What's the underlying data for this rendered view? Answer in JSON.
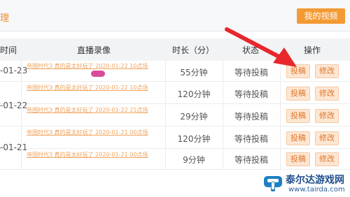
{
  "header": {
    "crumb": "理",
    "my_video_label": "我的视频"
  },
  "table": {
    "columns": [
      "时间",
      "直播录像",
      "时长（分）",
      "状态",
      "操作"
    ],
    "dates": [
      "-01-23",
      "-01-22",
      "-01-21"
    ],
    "rows": [
      {
        "title": "帝国时代3 真的是太好玩了 2020-01-22 10点场",
        "duration": "55分钟",
        "status": "等待投稿"
      },
      {
        "title": "帝国时代3 真的是太好玩了 2020-01-22 10点场",
        "duration": "120分钟",
        "status": "等待投稿"
      },
      {
        "title": "帝国时代3 真的是太好玩了 2020-01-22 21点场",
        "duration": "29分钟",
        "status": "等待投稿"
      },
      {
        "title": "帝国时代3 真的是太好玩了 2020-01-21 00点场",
        "duration": "120分钟",
        "status": "等待投稿"
      },
      {
        "title": "帝国时代3 真的是太好玩了 2020-01-21 00点场",
        "duration": "9分钟",
        "status": "等待投稿"
      }
    ],
    "submit_label": "投稿",
    "edit_label": "修改"
  },
  "watermark": {
    "name": "泰尔达游戏网",
    "url": "www.tairda.com"
  },
  "colors": {
    "accent": "#f39a33",
    "arrow": "#e8262b",
    "link": "#f0a25a"
  },
  "icons": [
    "red-arrow-pointer",
    "tairda-logo-icon"
  ]
}
